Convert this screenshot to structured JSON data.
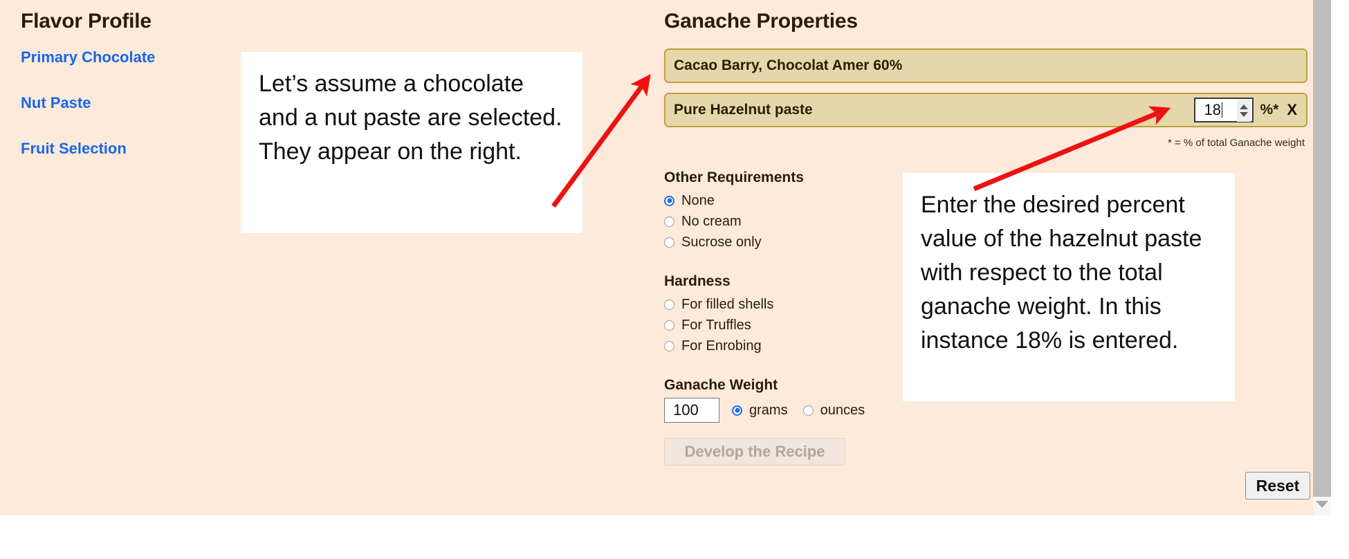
{
  "flavor_profile": {
    "heading": "Flavor Profile",
    "links": [
      {
        "label": "Primary Chocolate"
      },
      {
        "label": "Nut Paste"
      },
      {
        "label": "Fruit Selection"
      }
    ]
  },
  "ganache": {
    "heading": "Ganache Properties",
    "ingredients": [
      {
        "name": "Cacao Barry, Chocolat Amer 60%",
        "has_percent": false
      },
      {
        "name": "Pure Hazelnut paste",
        "has_percent": true,
        "percent_value": "18",
        "percent_unit": "%*",
        "remove_label": "X"
      }
    ],
    "footnote": "* = % of total Ganache weight"
  },
  "other_requirements": {
    "heading": "Other Requirements",
    "options": [
      {
        "label": "None",
        "selected": true
      },
      {
        "label": "No cream",
        "selected": false
      },
      {
        "label": "Sucrose only",
        "selected": false
      }
    ]
  },
  "hardness": {
    "heading": "Hardness",
    "options": [
      {
        "label": "For filled shells",
        "selected": false
      },
      {
        "label": "For Truffles",
        "selected": false
      },
      {
        "label": "For Enrobing",
        "selected": false
      }
    ]
  },
  "ganache_weight": {
    "heading": "Ganache Weight",
    "value": "100",
    "units": [
      {
        "label": "grams",
        "selected": true
      },
      {
        "label": "ounces",
        "selected": false
      }
    ]
  },
  "actions": {
    "develop_label": "Develop the Recipe",
    "reset_label": "Reset"
  },
  "annotations": {
    "left_text": "Let’s assume a chocolate and a nut paste are selected. They appear on the right.",
    "right_text": "Enter the desired percent value of the hazelnut paste with respect to the total ganache weight. In this instance 18% is entered."
  },
  "colors": {
    "page_background": "#fdeadb",
    "ingredient_row": "#e6d7ab",
    "ingredient_border": "#bfa03c",
    "link_blue": "#1a66e8",
    "heading_brown": "#2b1c08",
    "radio_blue": "#1a6fe0",
    "arrow_red": "#ee1111",
    "disabled_text": "#b0a89f"
  }
}
